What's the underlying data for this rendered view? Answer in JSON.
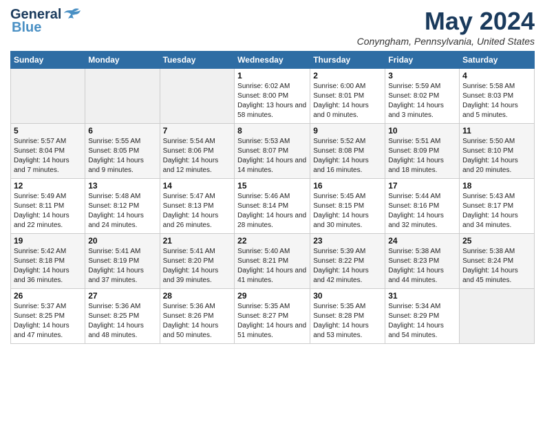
{
  "header": {
    "logo_general": "General",
    "logo_blue": "Blue",
    "month": "May 2024",
    "location": "Conyngham, Pennsylvania, United States"
  },
  "columns": [
    "Sunday",
    "Monday",
    "Tuesday",
    "Wednesday",
    "Thursday",
    "Friday",
    "Saturday"
  ],
  "weeks": [
    {
      "days": [
        {
          "num": "",
          "info": ""
        },
        {
          "num": "",
          "info": ""
        },
        {
          "num": "",
          "info": ""
        },
        {
          "num": "1",
          "info": "Sunrise: 6:02 AM\nSunset: 8:00 PM\nDaylight: 13 hours and 58 minutes."
        },
        {
          "num": "2",
          "info": "Sunrise: 6:00 AM\nSunset: 8:01 PM\nDaylight: 14 hours and 0 minutes."
        },
        {
          "num": "3",
          "info": "Sunrise: 5:59 AM\nSunset: 8:02 PM\nDaylight: 14 hours and 3 minutes."
        },
        {
          "num": "4",
          "info": "Sunrise: 5:58 AM\nSunset: 8:03 PM\nDaylight: 14 hours and 5 minutes."
        }
      ]
    },
    {
      "days": [
        {
          "num": "5",
          "info": "Sunrise: 5:57 AM\nSunset: 8:04 PM\nDaylight: 14 hours and 7 minutes."
        },
        {
          "num": "6",
          "info": "Sunrise: 5:55 AM\nSunset: 8:05 PM\nDaylight: 14 hours and 9 minutes."
        },
        {
          "num": "7",
          "info": "Sunrise: 5:54 AM\nSunset: 8:06 PM\nDaylight: 14 hours and 12 minutes."
        },
        {
          "num": "8",
          "info": "Sunrise: 5:53 AM\nSunset: 8:07 PM\nDaylight: 14 hours and 14 minutes."
        },
        {
          "num": "9",
          "info": "Sunrise: 5:52 AM\nSunset: 8:08 PM\nDaylight: 14 hours and 16 minutes."
        },
        {
          "num": "10",
          "info": "Sunrise: 5:51 AM\nSunset: 8:09 PM\nDaylight: 14 hours and 18 minutes."
        },
        {
          "num": "11",
          "info": "Sunrise: 5:50 AM\nSunset: 8:10 PM\nDaylight: 14 hours and 20 minutes."
        }
      ]
    },
    {
      "days": [
        {
          "num": "12",
          "info": "Sunrise: 5:49 AM\nSunset: 8:11 PM\nDaylight: 14 hours and 22 minutes."
        },
        {
          "num": "13",
          "info": "Sunrise: 5:48 AM\nSunset: 8:12 PM\nDaylight: 14 hours and 24 minutes."
        },
        {
          "num": "14",
          "info": "Sunrise: 5:47 AM\nSunset: 8:13 PM\nDaylight: 14 hours and 26 minutes."
        },
        {
          "num": "15",
          "info": "Sunrise: 5:46 AM\nSunset: 8:14 PM\nDaylight: 14 hours and 28 minutes."
        },
        {
          "num": "16",
          "info": "Sunrise: 5:45 AM\nSunset: 8:15 PM\nDaylight: 14 hours and 30 minutes."
        },
        {
          "num": "17",
          "info": "Sunrise: 5:44 AM\nSunset: 8:16 PM\nDaylight: 14 hours and 32 minutes."
        },
        {
          "num": "18",
          "info": "Sunrise: 5:43 AM\nSunset: 8:17 PM\nDaylight: 14 hours and 34 minutes."
        }
      ]
    },
    {
      "days": [
        {
          "num": "19",
          "info": "Sunrise: 5:42 AM\nSunset: 8:18 PM\nDaylight: 14 hours and 36 minutes."
        },
        {
          "num": "20",
          "info": "Sunrise: 5:41 AM\nSunset: 8:19 PM\nDaylight: 14 hours and 37 minutes."
        },
        {
          "num": "21",
          "info": "Sunrise: 5:41 AM\nSunset: 8:20 PM\nDaylight: 14 hours and 39 minutes."
        },
        {
          "num": "22",
          "info": "Sunrise: 5:40 AM\nSunset: 8:21 PM\nDaylight: 14 hours and 41 minutes."
        },
        {
          "num": "23",
          "info": "Sunrise: 5:39 AM\nSunset: 8:22 PM\nDaylight: 14 hours and 42 minutes."
        },
        {
          "num": "24",
          "info": "Sunrise: 5:38 AM\nSunset: 8:23 PM\nDaylight: 14 hours and 44 minutes."
        },
        {
          "num": "25",
          "info": "Sunrise: 5:38 AM\nSunset: 8:24 PM\nDaylight: 14 hours and 45 minutes."
        }
      ]
    },
    {
      "days": [
        {
          "num": "26",
          "info": "Sunrise: 5:37 AM\nSunset: 8:25 PM\nDaylight: 14 hours and 47 minutes."
        },
        {
          "num": "27",
          "info": "Sunrise: 5:36 AM\nSunset: 8:25 PM\nDaylight: 14 hours and 48 minutes."
        },
        {
          "num": "28",
          "info": "Sunrise: 5:36 AM\nSunset: 8:26 PM\nDaylight: 14 hours and 50 minutes."
        },
        {
          "num": "29",
          "info": "Sunrise: 5:35 AM\nSunset: 8:27 PM\nDaylight: 14 hours and 51 minutes."
        },
        {
          "num": "30",
          "info": "Sunrise: 5:35 AM\nSunset: 8:28 PM\nDaylight: 14 hours and 53 minutes."
        },
        {
          "num": "31",
          "info": "Sunrise: 5:34 AM\nSunset: 8:29 PM\nDaylight: 14 hours and 54 minutes."
        },
        {
          "num": "",
          "info": ""
        }
      ]
    }
  ]
}
